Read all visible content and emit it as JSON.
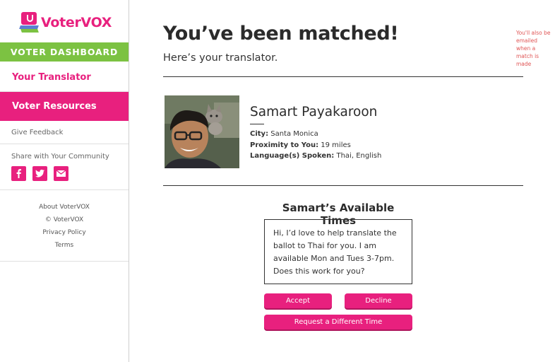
{
  "brand": {
    "name": "VoterVOX",
    "accent": "#e8207e",
    "green": "#7cc242",
    "blue": "#5b7fd1"
  },
  "sidebar": {
    "dashboard_label": "VOTER DASHBOARD",
    "nav": [
      {
        "label": "Your Translator"
      },
      {
        "label": "Voter Resources"
      }
    ],
    "feedback_label": "Give Feedback",
    "share_label": "Share with Your Community",
    "share_icons": [
      "facebook-icon",
      "twitter-icon",
      "email-icon"
    ],
    "footer_links": [
      "About VoterVOX",
      "© VoterVOX",
      "Privacy Policy",
      "Terms"
    ]
  },
  "main": {
    "title": "You’ve been matched!",
    "subtitle": "Here’s your translator.",
    "note": "You'll also be emailed when a match is made",
    "translator": {
      "name": "Samart Payakaroon",
      "city_label": "City:",
      "city": "Santa Monica",
      "proximity_label": "Proximity to You:",
      "proximity": "19 miles",
      "languages_label": "Language(s) Spoken:",
      "languages": "Thai, English"
    },
    "times_title": "Samart’s Available Times",
    "message": "Hi, I’d love to help translate the ballot to Thai for you. I am available Mon and Tues 3-7pm. Does this work for you?",
    "buttons": {
      "accept": "Accept",
      "decline": "Decline",
      "request": "Request a Different Time"
    }
  }
}
